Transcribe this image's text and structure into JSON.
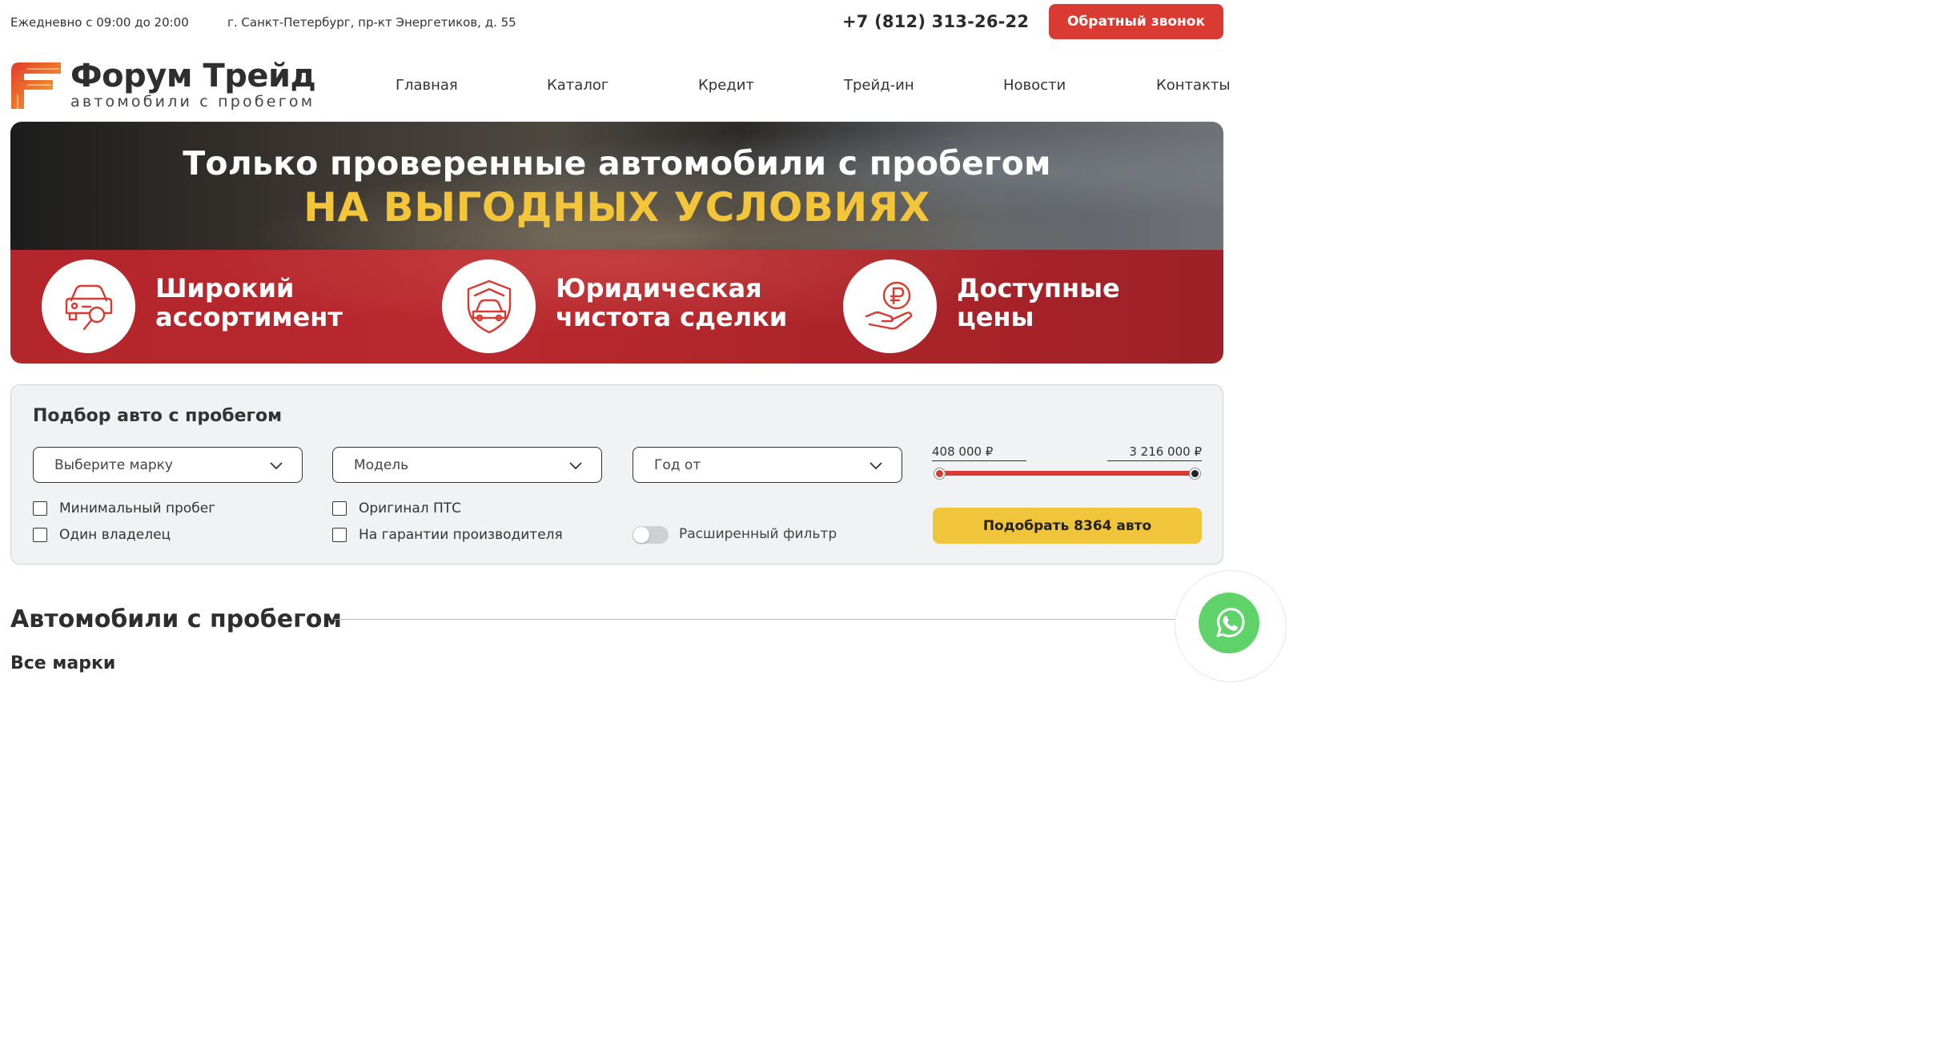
{
  "topbar": {
    "hours": "Ежедневно с 09:00 до 20:00",
    "address": "г. Санкт-Петербург, пр-кт Энергетиков, д. 55",
    "phone": "+7 (812) 313-26-22",
    "callback_label": "Обратный звонок"
  },
  "logo": {
    "title": "Форум Трейд",
    "subtitle": "автомобили с пробегом",
    "icon": "forum-f-logo-icon"
  },
  "nav": {
    "items": [
      "Главная",
      "Каталог",
      "Кредит",
      "Трейд-ин",
      "Новости",
      "Контакты"
    ]
  },
  "hero": {
    "title": "Только проверенные автомобили с пробегом",
    "accent": "НА ВЫГОДНЫХ УСЛОВИЯХ",
    "features": [
      {
        "line1": "Широкий",
        "line2": "ассортимент",
        "icon": "car-search-icon"
      },
      {
        "line1": "Юридическая",
        "line2": "чистота сделки",
        "icon": "car-shield-icon"
      },
      {
        "line1": "Доступные",
        "line2": "цены",
        "icon": "ruble-hand-icon"
      }
    ]
  },
  "filter": {
    "title": "Подбор авто с пробегом",
    "brand_select": "Выберите марку",
    "model_select": "Модель",
    "year_select": "Год от",
    "checks": {
      "min_mileage": "Минимальный пробег",
      "one_owner": "Один владелец",
      "original_pts": "Оригинал ПТС",
      "warranty": "На гарантии производителя"
    },
    "extended_filter": "Расширенный фильтр",
    "price_min": "408 000 ₽",
    "price_max": "3 216 000 ₽",
    "submit": "Подобрать 8364 авто"
  },
  "section": {
    "title": "Автомобили с пробегом",
    "brands_title": "Все марки"
  },
  "colors": {
    "accent_red": "#d93a32",
    "accent_yellow": "#f0c43b",
    "whatsapp_green": "#5fd36a"
  },
  "floating": {
    "icon": "whatsapp-icon"
  }
}
